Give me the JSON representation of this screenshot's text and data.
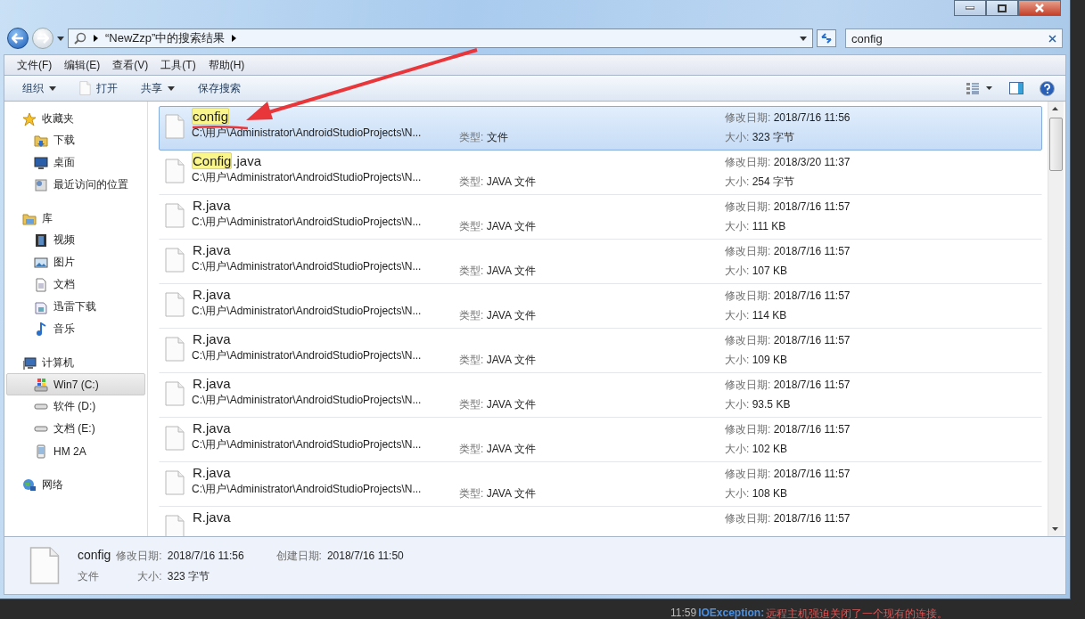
{
  "address": {
    "crumb": "“NewZzp”中的搜索结果"
  },
  "search": {
    "value": "config"
  },
  "menu": [
    "文件(F)",
    "编辑(E)",
    "查看(V)",
    "工具(T)",
    "帮助(H)"
  ],
  "toolbar": [
    {
      "label": "组织",
      "kind": "dropdown"
    },
    {
      "label": "打开",
      "kind": "file"
    },
    {
      "label": "共享",
      "kind": "dropdown"
    },
    {
      "label": "保存搜索",
      "kind": "plain"
    }
  ],
  "sidebar": {
    "groups": [
      {
        "label": "收藏夹",
        "items": [
          {
            "label": "下载",
            "selected": false
          },
          {
            "label": "桌面",
            "selected": false
          },
          {
            "label": "最近访问的位置",
            "selected": false
          }
        ]
      },
      {
        "label": "库",
        "items": [
          {
            "label": "视频",
            "selected": false
          },
          {
            "label": "图片",
            "selected": false
          },
          {
            "label": "文档",
            "selected": false
          },
          {
            "label": "迅雷下载",
            "selected": false
          },
          {
            "label": "音乐",
            "selected": false
          }
        ]
      },
      {
        "label": "计算机",
        "items": [
          {
            "label": "Win7 (C:)",
            "selected": true
          },
          {
            "label": "软件 (D:)",
            "selected": false
          },
          {
            "label": "文档 (E:)",
            "selected": false
          },
          {
            "label": "HM 2A",
            "selected": false
          }
        ]
      },
      {
        "label": "网络"
      }
    ]
  },
  "results": [
    {
      "name": [
        {
          "text": "config",
          "highlighted": true
        }
      ],
      "path": "C:\\用户\\Administrator\\AndroidStudioProjects\\N...",
      "type_label": "类型:",
      "type": "文件",
      "date_label": "修改日期:",
      "date": "2018/7/16 11:56",
      "size_label": "大小:",
      "size": "323 字节",
      "selected": true
    },
    {
      "name": [
        {
          "text": "Config",
          "highlighted": true
        },
        {
          "text": ".java",
          "highlighted": false
        }
      ],
      "path": "C:\\用户\\Administrator\\AndroidStudioProjects\\N...",
      "type_label": "类型:",
      "type": "JAVA 文件",
      "date_label": "修改日期:",
      "date": "2018/3/20 11:37",
      "size_label": "大小:",
      "size": "254 字节",
      "selected": false
    },
    {
      "name": [
        {
          "text": "R.java",
          "highlighted": false
        }
      ],
      "path": "C:\\用户\\Administrator\\AndroidStudioProjects\\N...",
      "type_label": "类型:",
      "type": "JAVA 文件",
      "date_label": "修改日期:",
      "date": "2018/7/16 11:57",
      "size_label": "大小:",
      "size": "111 KB",
      "selected": false
    },
    {
      "name": [
        {
          "text": "R.java",
          "highlighted": false
        }
      ],
      "path": "C:\\用户\\Administrator\\AndroidStudioProjects\\N...",
      "type_label": "类型:",
      "type": "JAVA 文件",
      "date_label": "修改日期:",
      "date": "2018/7/16 11:57",
      "size_label": "大小:",
      "size": "107 KB",
      "selected": false
    },
    {
      "name": [
        {
          "text": "R.java",
          "highlighted": false
        }
      ],
      "path": "C:\\用户\\Administrator\\AndroidStudioProjects\\N...",
      "type_label": "类型:",
      "type": "JAVA 文件",
      "date_label": "修改日期:",
      "date": "2018/7/16 11:57",
      "size_label": "大小:",
      "size": "114 KB",
      "selected": false
    },
    {
      "name": [
        {
          "text": "R.java",
          "highlighted": false
        }
      ],
      "path": "C:\\用户\\Administrator\\AndroidStudioProjects\\N...",
      "type_label": "类型:",
      "type": "JAVA 文件",
      "date_label": "修改日期:",
      "date": "2018/7/16 11:57",
      "size_label": "大小:",
      "size": "109 KB",
      "selected": false
    },
    {
      "name": [
        {
          "text": "R.java",
          "highlighted": false
        }
      ],
      "path": "C:\\用户\\Administrator\\AndroidStudioProjects\\N...",
      "type_label": "类型:",
      "type": "JAVA 文件",
      "date_label": "修改日期:",
      "date": "2018/7/16 11:57",
      "size_label": "大小:",
      "size": "93.5 KB",
      "selected": false
    },
    {
      "name": [
        {
          "text": "R.java",
          "highlighted": false
        }
      ],
      "path": "C:\\用户\\Administrator\\AndroidStudioProjects\\N...",
      "type_label": "类型:",
      "type": "JAVA 文件",
      "date_label": "修改日期:",
      "date": "2018/7/16 11:57",
      "size_label": "大小:",
      "size": "102 KB",
      "selected": false
    },
    {
      "name": [
        {
          "text": "R.java",
          "highlighted": false
        }
      ],
      "path": "C:\\用户\\Administrator\\AndroidStudioProjects\\N...",
      "type_label": "类型:",
      "type": "JAVA 文件",
      "date_label": "修改日期:",
      "date": "2018/7/16 11:57",
      "size_label": "大小:",
      "size": "108 KB",
      "selected": false
    },
    {
      "name": [
        {
          "text": "R.java",
          "highlighted": false
        }
      ],
      "date_label": "修改日期:",
      "date": "2018/7/16 11:57",
      "selected": false
    }
  ],
  "details": {
    "name": "config",
    "type": "文件",
    "modified_label": "修改日期:",
    "modified": "2018/7/16 11:56",
    "created_label": "创建日期:",
    "created": "2018/7/16 11:50",
    "size_label": "大小:",
    "size": "323 字节"
  },
  "console": {
    "time": "11:59",
    "exception": "IOException:",
    "message": "远程主机强迫关闭了一个现有的连接。"
  },
  "annotation": {
    "kind": "arrow"
  }
}
